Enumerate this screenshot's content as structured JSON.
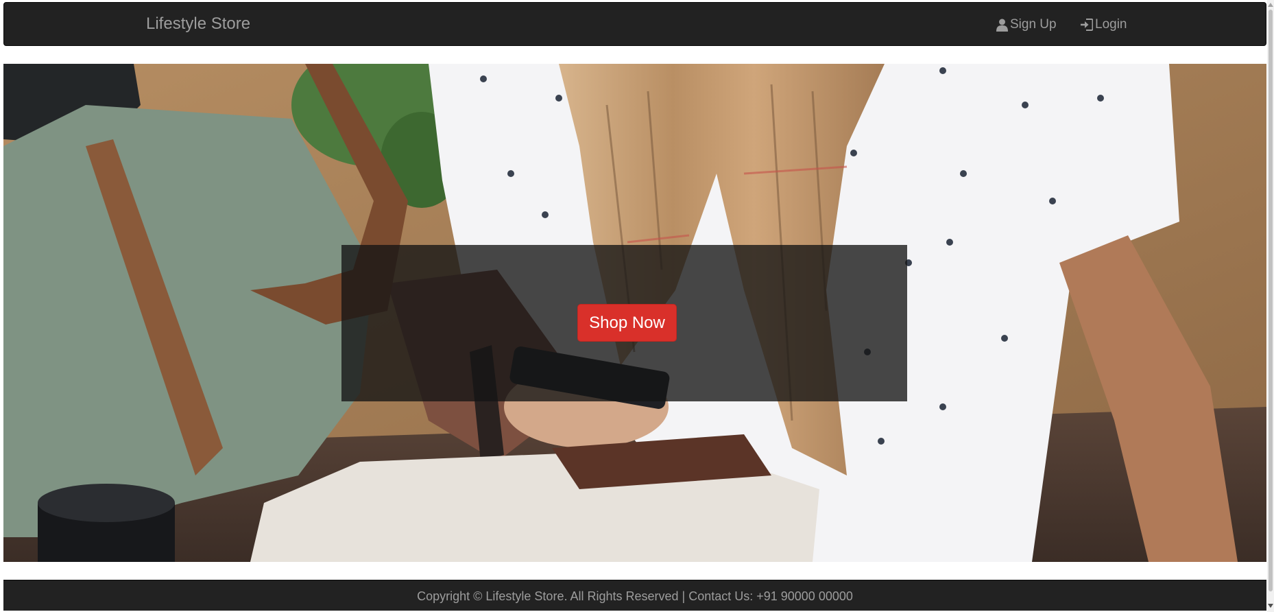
{
  "navbar": {
    "brand": "Lifestyle Store",
    "links": [
      {
        "label": "Sign Up",
        "icon": "user-icon"
      },
      {
        "label": "Login",
        "icon": "log-in-icon"
      }
    ]
  },
  "hero": {
    "cta_label": "Shop Now"
  },
  "footer": {
    "text": "Copyright © Lifestyle Store. All Rights Reserved | Contact Us: +91 90000 00000"
  },
  "colors": {
    "navbar_bg": "#222222",
    "navbar_text": "#9d9d9d",
    "cta_bg": "#d9302a",
    "footer_bg": "#222222"
  }
}
